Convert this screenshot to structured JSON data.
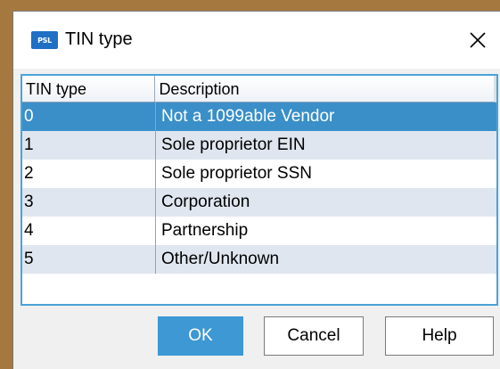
{
  "dialog": {
    "title": "TIN type",
    "app_icon_text": "PSL",
    "close_icon": "close-icon"
  },
  "table": {
    "columns": [
      "TIN type",
      "Description"
    ],
    "rows": [
      {
        "code": "0",
        "description": "Not a 1099able Vendor",
        "selected": true
      },
      {
        "code": "1",
        "description": "Sole proprietor EIN",
        "selected": false
      },
      {
        "code": "2",
        "description": "Sole proprietor SSN",
        "selected": false
      },
      {
        "code": "3",
        "description": "Corporation",
        "selected": false
      },
      {
        "code": "4",
        "description": "Partnership",
        "selected": false
      },
      {
        "code": "5",
        "description": "Other/Unknown",
        "selected": false
      }
    ]
  },
  "buttons": {
    "ok": "OK",
    "cancel": "Cancel",
    "help": "Help"
  },
  "colors": {
    "selection": "#3a8fc9",
    "alt_row": "#dfe6ef",
    "accent_border": "#4aa3d8"
  }
}
